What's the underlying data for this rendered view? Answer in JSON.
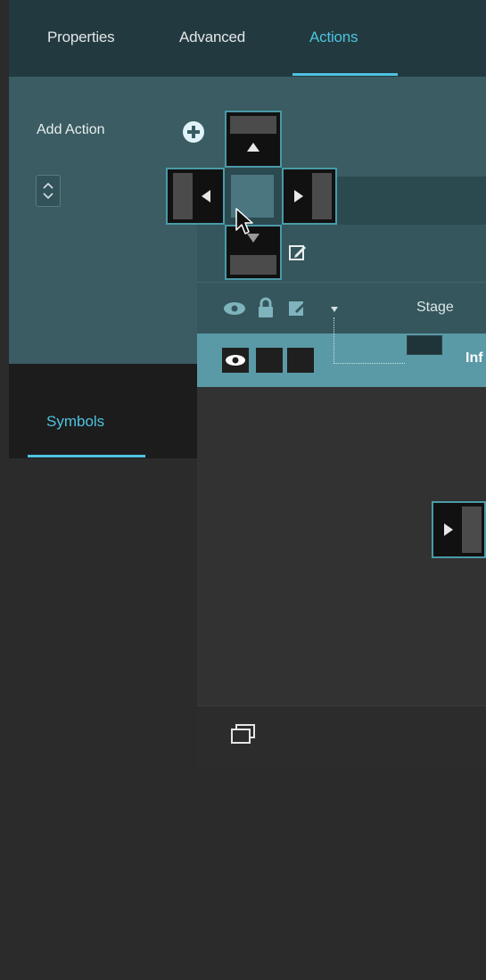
{
  "tabs": {
    "properties": "Properties",
    "advanced": "Advanced",
    "actions": "Actions"
  },
  "actions_panel": {
    "add_action_label": "Add Action"
  },
  "layers": {
    "stage_label": "Stage",
    "layer_name": "Inf"
  },
  "symbols": {
    "tab_label": "Symbols"
  },
  "colors": {
    "accent": "#4ec3e0",
    "tab_bar": "#223a3f",
    "actions_panel": "#3a5c62",
    "selected_layer_row": "#5a9aa6",
    "dock_border": "#4a9aa8"
  },
  "icons": {
    "add": "plus-circle-icon",
    "stepper": "up-down-stepper-icon",
    "edit": "edit-icon",
    "visibility": "eye-icon",
    "lock": "lock-icon",
    "expand": "disclosure-triangle-icon",
    "symbols_library": "stacked-windows-icon",
    "cursor": "pointer-cursor-icon"
  }
}
